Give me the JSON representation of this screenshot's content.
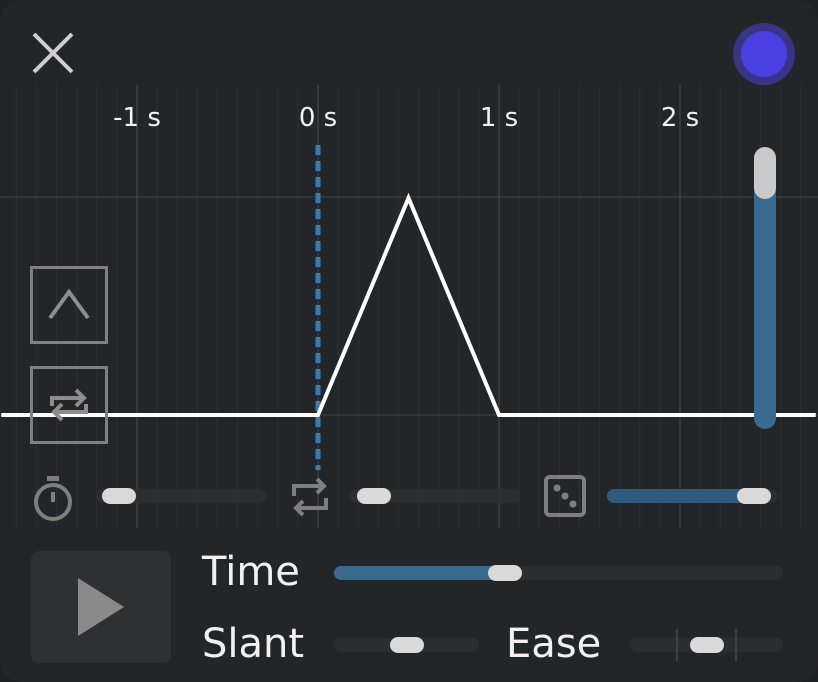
{
  "time_axis": {
    "ticks": [
      "-1 s",
      "0 s",
      "1 s",
      "2 s"
    ]
  },
  "envelope": {
    "shape": "triangle",
    "points_seconds": [
      [
        -1.75,
        0
      ],
      [
        0,
        0
      ],
      [
        0.5,
        1
      ],
      [
        1,
        0
      ],
      [
        2.75,
        0
      ]
    ],
    "playhead_seconds": 0
  },
  "controls": {
    "level_slider": 0.9,
    "timer_slider": 0.05,
    "repeat_slider": 0.05,
    "random_slider": 0.95,
    "time_slider": 0.37,
    "slant_slider": 0.5,
    "ease_slider": 0.5
  },
  "labels": {
    "time": "Time",
    "slant": "Slant",
    "ease": "Ease"
  },
  "colors": {
    "accent": "#3d6e93",
    "record_dot": "#4a3fe0",
    "curve": "#ffffff"
  },
  "icons": [
    "close-icon",
    "record-dot-icon",
    "chevron-up-icon",
    "loop-icon",
    "stopwatch-icon",
    "repeat-icon",
    "dice-icon",
    "play-icon"
  ]
}
